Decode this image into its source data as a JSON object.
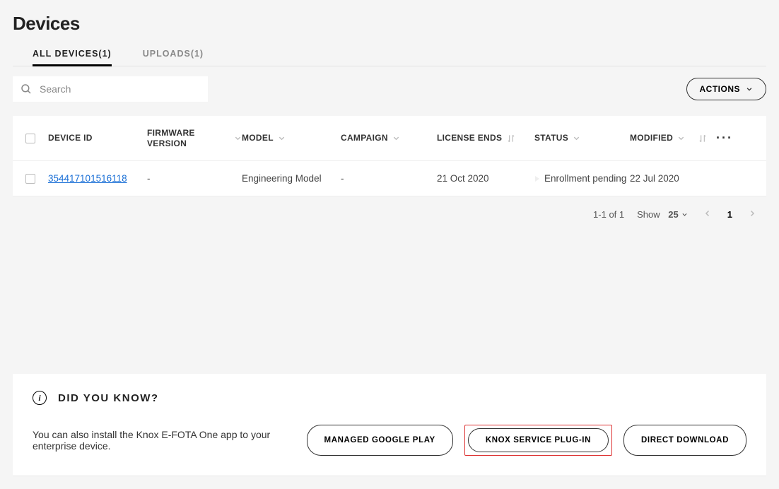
{
  "page_title": "Devices",
  "tabs": [
    {
      "label": "ALL DEVICES(1)",
      "active": true
    },
    {
      "label": "UPLOADS(1)",
      "active": false
    }
  ],
  "search_placeholder": "Search",
  "actions_label": "ACTIONS",
  "columns": {
    "device_id": "DEVICE ID",
    "firmware": "FIRMWARE VERSION",
    "model": "MODEL",
    "campaign": "CAMPAIGN",
    "license_ends": "LICENSE ENDS",
    "status": "STATUS",
    "modified": "MODIFIED"
  },
  "rows": [
    {
      "device_id": "354417101516118",
      "firmware": "-",
      "model": "Engineering Model",
      "campaign": "-",
      "license_ends": "21 Oct 2020",
      "status": "Enrollment pending",
      "modified": "22 Jul 2020"
    }
  ],
  "pagination": {
    "range": "1-1 of 1",
    "show_label": "Show",
    "per_page": "25",
    "current_page": "1"
  },
  "info": {
    "title": "DID YOU KNOW?",
    "text": "You can also install the Knox E-FOTA One app to your enterprise device.",
    "buttons": {
      "google_play": "MANAGED GOOGLE PLAY",
      "service_plugin": "KNOX SERVICE PLUG-IN",
      "direct_download": "DIRECT DOWNLOAD"
    }
  }
}
